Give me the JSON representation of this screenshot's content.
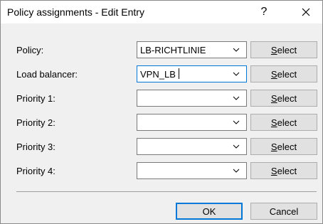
{
  "window": {
    "title": "Policy assignments - Edit Entry",
    "help_label": "?",
    "close_icon": "close-icon"
  },
  "rows": [
    {
      "label": "Policy:",
      "value": "LB-RICHTLINIE",
      "select_mnemonic": "S",
      "select_rest": "elect"
    },
    {
      "label": "Load balancer:",
      "value": "VPN_LB",
      "select_mnemonic": "S",
      "select_rest": "elect"
    },
    {
      "label": "Priority 1:",
      "value": "",
      "select_mnemonic": "S",
      "select_rest": "elect"
    },
    {
      "label": "Priority 2:",
      "value": "",
      "select_mnemonic": "S",
      "select_rest": "elect"
    },
    {
      "label": "Priority 3:",
      "value": "",
      "select_mnemonic": "S",
      "select_rest": "elect"
    },
    {
      "label": "Priority 4:",
      "value": "",
      "select_mnemonic": "S",
      "select_rest": "elect"
    }
  ],
  "footer": {
    "ok_label": "OK",
    "cancel_label": "Cancel"
  },
  "colors": {
    "focus_border": "#0078d7",
    "button_face": "#e1e1e1",
    "dialog_bg": "#f0f0f0"
  }
}
